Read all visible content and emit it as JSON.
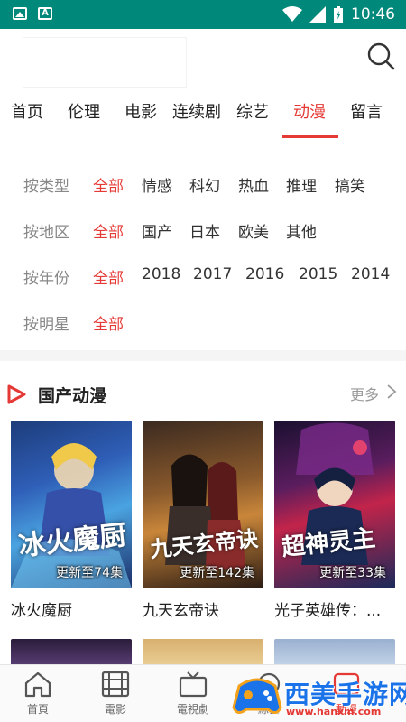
{
  "status_bar": {
    "time": "10:46"
  },
  "nav": {
    "tabs": [
      "首页",
      "伦理",
      "电影",
      "连续剧",
      "综艺",
      "动漫",
      "留言"
    ],
    "active": "动漫"
  },
  "filters": [
    {
      "label": "按类型",
      "options": [
        "全部",
        "情感",
        "科幻",
        "热血",
        "推理",
        "搞笑"
      ]
    },
    {
      "label": "按地区",
      "options": [
        "全部",
        "国产",
        "日本",
        "欧美",
        "其他"
      ]
    },
    {
      "label": "按年份",
      "options": [
        "全部",
        "2018",
        "2017",
        "2016",
        "2015",
        "2014"
      ]
    },
    {
      "label": "按明星",
      "options": [
        "全部"
      ]
    }
  ],
  "section": {
    "title": "国产动漫",
    "more": "更多",
    "items": [
      {
        "title": "冰火魔厨",
        "art_title": "冰火魔厨",
        "episodes": "更新至74集"
      },
      {
        "title": "九天玄帝诀",
        "art_title": "九天玄帝诀",
        "episodes": "更新至142集"
      },
      {
        "title": "光子英雄传：...",
        "art_title": "超神灵主",
        "episodes": "更新至33集"
      }
    ]
  },
  "bottom_tabs": [
    "首頁",
    "電影",
    "電視劇",
    "綜藝",
    "動漫"
  ],
  "watermark": {
    "text": "西美手游网",
    "url": "www.hanxm.com"
  },
  "colors": {
    "accent": "#e53935",
    "status_bar": "#00897b",
    "watermark": "#1a73e8"
  }
}
